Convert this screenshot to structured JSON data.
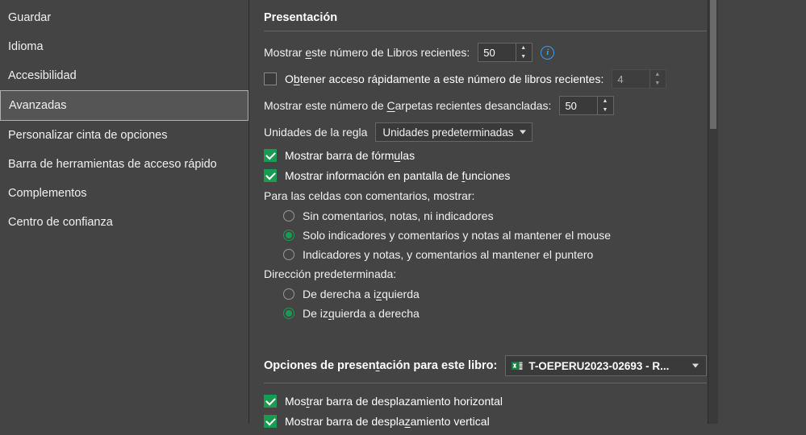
{
  "sidebar": {
    "items": [
      {
        "label": "Guardar"
      },
      {
        "label": "Idioma"
      },
      {
        "label": "Accesibilidad"
      },
      {
        "label": "Avanzadas"
      },
      {
        "label": "Personalizar cinta de opciones"
      },
      {
        "label": "Barra de herramientas de acceso rápido"
      },
      {
        "label": "Complementos"
      },
      {
        "label": "Centro de confianza"
      }
    ],
    "selected_index": 3
  },
  "presentation": {
    "title": "Presentación",
    "recent_books_label_pre": "Mostrar ",
    "recent_books_label_u": "e",
    "recent_books_label_post": "ste número de Libros recientes:",
    "recent_books_value": "50",
    "quick_access_pre": "O",
    "quick_access_u": "b",
    "quick_access_post": "tener acceso rápidamente a este número de libros recientes:",
    "quick_access_value": "4",
    "quick_access_checked": false,
    "recent_folders_pre": "Mostrar este número de ",
    "recent_folders_u": "C",
    "recent_folders_post": "arpetas recientes desancladas:",
    "recent_folders_value": "50",
    "ruler_units_label": "Unidades de la regla",
    "ruler_units_value": "Unidades predeterminadas",
    "show_formula_bar_pre": "Mostrar barra de fórm",
    "show_formula_bar_u": "u",
    "show_formula_bar_post": "las",
    "show_formula_bar_checked": true,
    "show_func_tooltips_pre": "Mostrar información en pantalla de ",
    "show_func_tooltips_u": "f",
    "show_func_tooltips_post": "unciones",
    "show_func_tooltips_checked": true,
    "comments_header": "Para las celdas con comentarios, mostrar:",
    "comments_options": [
      {
        "label": "Sin comentarios, notas, ni indicadores",
        "checked": false
      },
      {
        "label": "Solo indicadores y comentarios y notas al mantener el mouse",
        "checked": true
      },
      {
        "label": "Indicadores y notas, y comentarios al mantener el puntero",
        "checked": false
      }
    ],
    "direction_header": "Dirección predeterminada:",
    "direction_options": [
      {
        "pre": "De derecha a i",
        "u": "z",
        "post": "quierda",
        "checked": false
      },
      {
        "pre": "De iz",
        "u": "q",
        "post": "uierda a derecha",
        "checked": true
      }
    ]
  },
  "workbook": {
    "title_pre": "Opciones de presen",
    "title_u": "t",
    "title_post": "ación para este libro:",
    "selected": "T-OEPERU2023-02693 - R...",
    "hscroll_pre": "Mos",
    "hscroll_u": "t",
    "hscroll_post": "rar barra de desplazamiento horizontal",
    "hscroll_checked": true,
    "vscroll_pre": "Mostrar barra de despla",
    "vscroll_u": "z",
    "vscroll_post": "amiento vertical",
    "vscroll_checked": true
  }
}
